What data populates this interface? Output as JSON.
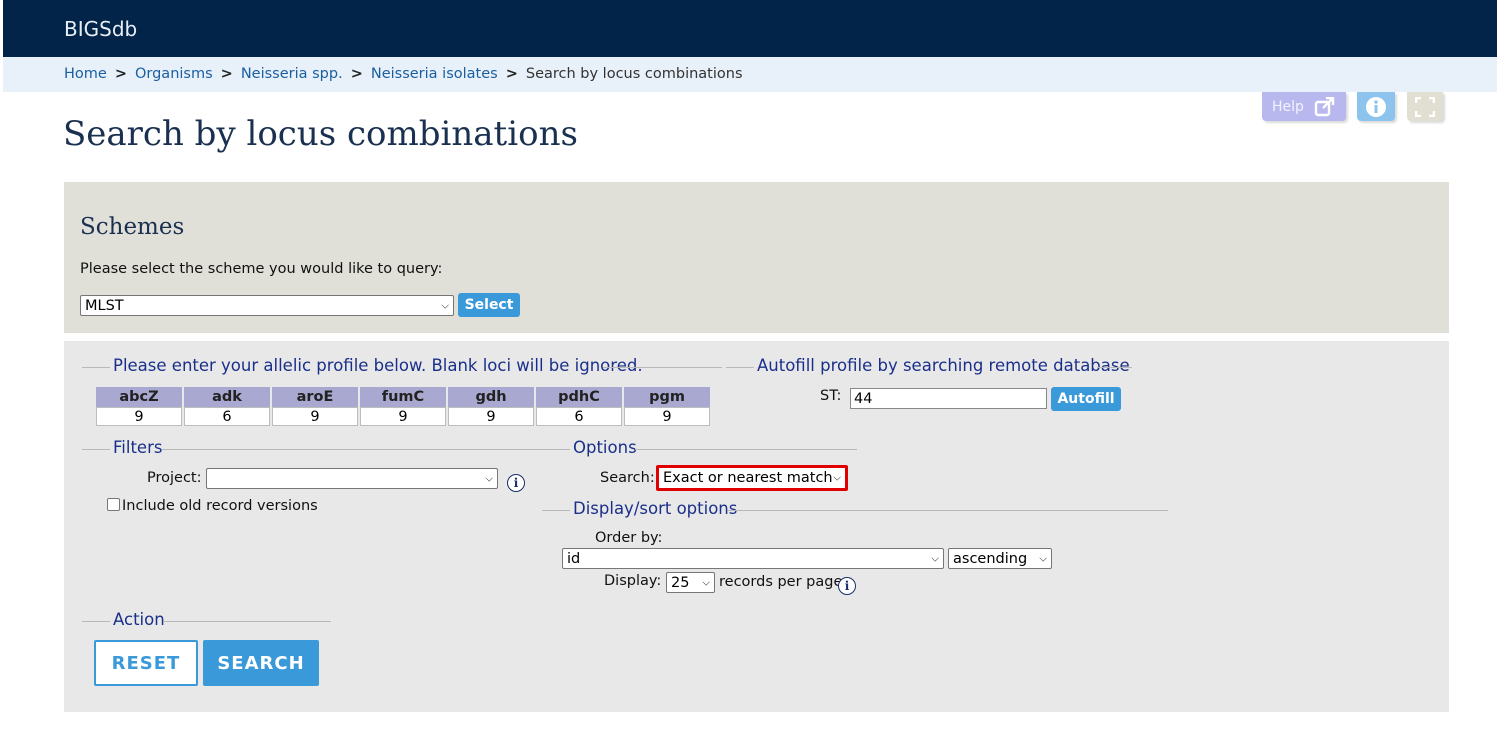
{
  "app": {
    "title": "BIGSdb"
  },
  "breadcrumb": [
    {
      "label": "Home"
    },
    {
      "label": "Organisms"
    },
    {
      "label": "Neisseria spp."
    },
    {
      "label": "Neisseria isolates"
    },
    {
      "label": "Search by locus combinations"
    }
  ],
  "toolbar": {
    "help_label": "Help",
    "help_icon": "external-link-icon",
    "info_icon": "info-icon",
    "fullscreen_icon": "expand-icon"
  },
  "page": {
    "title": "Search by locus combinations"
  },
  "schemes": {
    "heading": "Schemes",
    "prompt": "Please select the scheme you would like to query:",
    "selected": "MLST",
    "select_button": "Select"
  },
  "profile": {
    "legend": "Please enter your allelic profile below. Blank loci will be ignored.",
    "loci": [
      {
        "name": "abcZ",
        "value": "9"
      },
      {
        "name": "adk",
        "value": "6"
      },
      {
        "name": "aroE",
        "value": "9"
      },
      {
        "name": "fumC",
        "value": "9"
      },
      {
        "name": "gdh",
        "value": "9"
      },
      {
        "name": "pdhC",
        "value": "6"
      },
      {
        "name": "pgm",
        "value": "9"
      }
    ]
  },
  "autofill": {
    "legend": "Autofill profile by searching remote database",
    "st_label": "ST:",
    "st_value": "44",
    "button": "Autofill"
  },
  "filters": {
    "legend": "Filters",
    "project_label": "Project:",
    "project_value": "",
    "old_versions_label": "Include old record versions",
    "old_versions_checked": false
  },
  "options": {
    "legend": "Options",
    "search_label": "Search:",
    "search_value": "Exact or nearest match",
    "highlight_color": "#e00000"
  },
  "display": {
    "legend": "Display/sort options",
    "order_label": "Order by:",
    "order_value": "id",
    "direction_value": "ascending",
    "display_label": "Display:",
    "display_value": "25",
    "records_label": "records per page"
  },
  "action": {
    "legend": "Action",
    "reset_label": "RESET",
    "search_label": "SEARCH"
  }
}
